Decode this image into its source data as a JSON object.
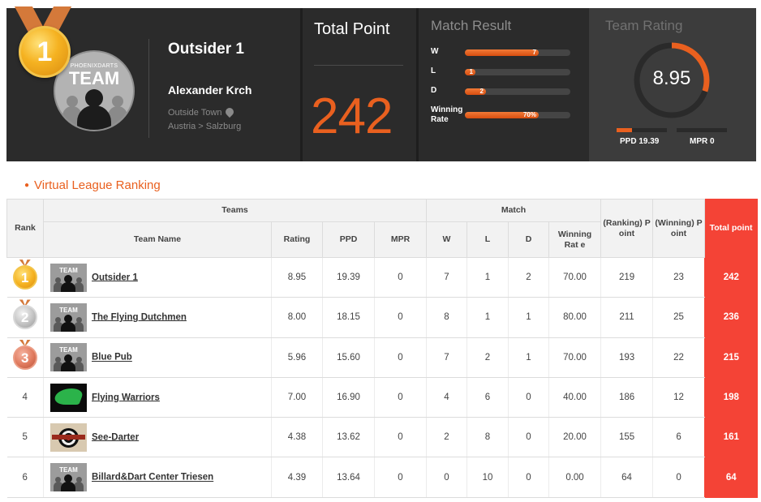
{
  "header": {
    "rank_medal": "1",
    "team_logo_small": "PHOENIXDARTS",
    "team_logo_big": "TEAM",
    "team_name": "Outsider 1",
    "player_name": "Alexander Krch",
    "location_line1": "Outside Town",
    "location_line2": "Austria > Salzburg",
    "total_point_title": "Total Point",
    "total_point_value": "242",
    "match_result": {
      "title": "Match Result",
      "rows": [
        {
          "label": "W",
          "value": "7",
          "fraction": 0.7
        },
        {
          "label": "L",
          "value": "1",
          "fraction": 0.1
        },
        {
          "label": "D",
          "value": "2",
          "fraction": 0.2
        },
        {
          "label": "Winning Rate",
          "value": "70%",
          "fraction": 0.7
        }
      ]
    },
    "team_rating": {
      "title": "Team Rating",
      "value": "8.95",
      "ring_fraction": 0.3,
      "ppd_label": "PPD 19.39",
      "ppd_fraction": 0.3,
      "mpr_label": "MPR 0",
      "mpr_fraction": 0.0
    }
  },
  "section_title": "Virtual League Ranking",
  "table": {
    "headers": {
      "rank": "Rank",
      "teams_group": "Teams",
      "match_group": "Match",
      "team_name": "Team Name",
      "rating": "Rating",
      "ppd": "PPD",
      "mpr": "MPR",
      "w": "W",
      "l": "L",
      "d": "D",
      "winning_rate": "Winning Rat e",
      "ranking_point": "(Ranking) P oint",
      "winning_point": "(Winning) P oint",
      "total_point": "Total point"
    },
    "rows": [
      {
        "rank": "1",
        "team": "Outsider 1",
        "rating": "8.95",
        "ppd": "19.39",
        "mpr": "0",
        "w": "7",
        "l": "1",
        "d": "2",
        "winning_rate": "70.00",
        "ranking_point": "219",
        "winning_point": "23",
        "total_point": "242"
      },
      {
        "rank": "2",
        "team": "The Flying Dutchmen",
        "rating": "8.00",
        "ppd": "18.15",
        "mpr": "0",
        "w": "8",
        "l": "1",
        "d": "1",
        "winning_rate": "80.00",
        "ranking_point": "211",
        "winning_point": "25",
        "total_point": "236"
      },
      {
        "rank": "3",
        "team": "Blue Pub",
        "rating": "5.96",
        "ppd": "15.60",
        "mpr": "0",
        "w": "7",
        "l": "2",
        "d": "1",
        "winning_rate": "70.00",
        "ranking_point": "193",
        "winning_point": "22",
        "total_point": "215"
      },
      {
        "rank": "4",
        "team": "Flying Warriors",
        "rating": "7.00",
        "ppd": "16.90",
        "mpr": "0",
        "w": "4",
        "l": "6",
        "d": "0",
        "winning_rate": "40.00",
        "ranking_point": "186",
        "winning_point": "12",
        "total_point": "198"
      },
      {
        "rank": "5",
        "team": "See-Darter",
        "rating": "4.38",
        "ppd": "13.62",
        "mpr": "0",
        "w": "2",
        "l": "8",
        "d": "0",
        "winning_rate": "20.00",
        "ranking_point": "155",
        "winning_point": "6",
        "total_point": "161"
      },
      {
        "rank": "6",
        "team": "Billard&Dart Center Triesen",
        "rating": "4.39",
        "ppd": "13.64",
        "mpr": "0",
        "w": "0",
        "l": "10",
        "d": "0",
        "winning_rate": "0.00",
        "ranking_point": "64",
        "winning_point": "0",
        "total_point": "64"
      }
    ],
    "thumb_label": "TEAM"
  },
  "colors": {
    "accent_orange": "#e9601f",
    "total_red": "#f44336",
    "panel_dark": "#2b2b2b"
  },
  "icons": [
    "gold-medal-icon",
    "silver-medal-icon",
    "bronze-medal-icon",
    "location-pin-icon"
  ]
}
